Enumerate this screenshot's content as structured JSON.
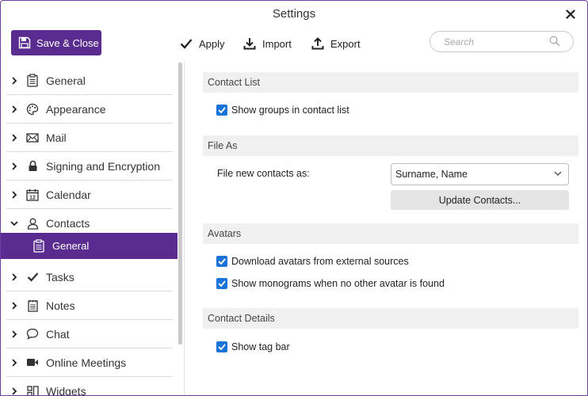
{
  "window": {
    "title": "Settings"
  },
  "toolbar": {
    "save_close_label": "Save & Close",
    "apply_label": "Apply",
    "import_label": "Import",
    "export_label": "Export",
    "search_placeholder": "Search"
  },
  "sidebar": {
    "items": [
      {
        "label": "General",
        "icon": "clipboard-icon"
      },
      {
        "label": "Appearance",
        "icon": "palette-icon"
      },
      {
        "label": "Mail",
        "icon": "envelope-icon"
      },
      {
        "label": "Signing and Encryption",
        "icon": "lock-icon"
      },
      {
        "label": "Calendar",
        "icon": "calendar-icon"
      },
      {
        "label": "Contacts",
        "icon": "person-icon",
        "expanded": true
      },
      {
        "label": "Tasks",
        "icon": "checkmark-icon"
      },
      {
        "label": "Notes",
        "icon": "notepad-icon"
      },
      {
        "label": "Chat",
        "icon": "speech-bubble-icon"
      },
      {
        "label": "Online Meetings",
        "icon": "video-camera-icon"
      },
      {
        "label": "Widgets",
        "icon": "widgets-icon"
      }
    ],
    "active_sub": {
      "label": "General",
      "icon": "clipboard-icon"
    }
  },
  "content": {
    "sections": {
      "contact_list": {
        "title": "Contact List",
        "show_groups": {
          "label": "Show groups in contact list",
          "checked": true
        }
      },
      "file_as": {
        "title": "File As",
        "field_label": "File new contacts as:",
        "select_value": "Surname, Name",
        "update_button": "Update Contacts..."
      },
      "avatars": {
        "title": "Avatars",
        "download": {
          "label": "Download avatars from external sources",
          "checked": true
        },
        "monograms": {
          "label": "Show monograms when no other avatar is found",
          "checked": true
        }
      },
      "contact_details": {
        "title": "Contact Details",
        "tag_bar": {
          "label": "Show tag bar",
          "checked": true
        }
      }
    }
  },
  "colors": {
    "accent": "#5b2c8f",
    "checkbox": "#1a73d6"
  }
}
